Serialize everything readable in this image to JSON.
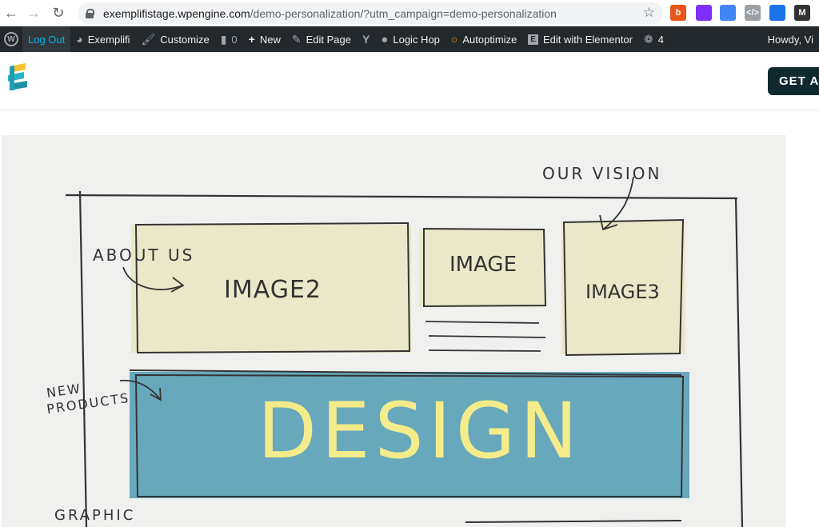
{
  "browser": {
    "url_host": "exemplifistage.wpengine.com",
    "url_path": "/demo-personalization/?utm_campaign=demo-personalization",
    "extensions": [
      {
        "name": "b-extension-icon",
        "color": "#e8541a",
        "glyph": "b"
      },
      {
        "name": "color-ring-icon",
        "color": "#7b2ff7",
        "glyph": ""
      },
      {
        "name": "puzzle-extension-icon",
        "color": "#4285f4",
        "glyph": ""
      },
      {
        "name": "code-extension-icon",
        "color": "#9aa0a6",
        "glyph": "</>"
      },
      {
        "name": "page-extension-icon",
        "color": "#1a73e8",
        "glyph": ""
      },
      {
        "name": "m-extension-icon",
        "color": "#333333",
        "glyph": "M"
      }
    ]
  },
  "adminbar": {
    "logout": "Log Out",
    "site": "Exemplifi",
    "customize": "Customize",
    "comments": "0",
    "new": "New",
    "edit_page": "Edit Page",
    "logic_hop": "Logic Hop",
    "autoptimize": "Autoptimize",
    "elementor": "Edit with Elementor",
    "updates": "4",
    "howdy": "Howdy, Vi"
  },
  "header": {
    "cta": "GET A"
  },
  "sketch": {
    "our_vision": "OUR VISION",
    "about_us": "ABOUT US",
    "image2": "IMAGE2",
    "image": "IMAGE",
    "image3": "IMAGE3",
    "new_products_1": "NEW",
    "new_products_2": "PRODUCTS",
    "design": "DESIGN",
    "graphic": "GRAPHIC",
    "colors": {
      "paper": "#f0f0ef",
      "box_fill": "#ebe7c9",
      "banner": "#68a8bc",
      "design_text": "#f4ec8a"
    }
  }
}
